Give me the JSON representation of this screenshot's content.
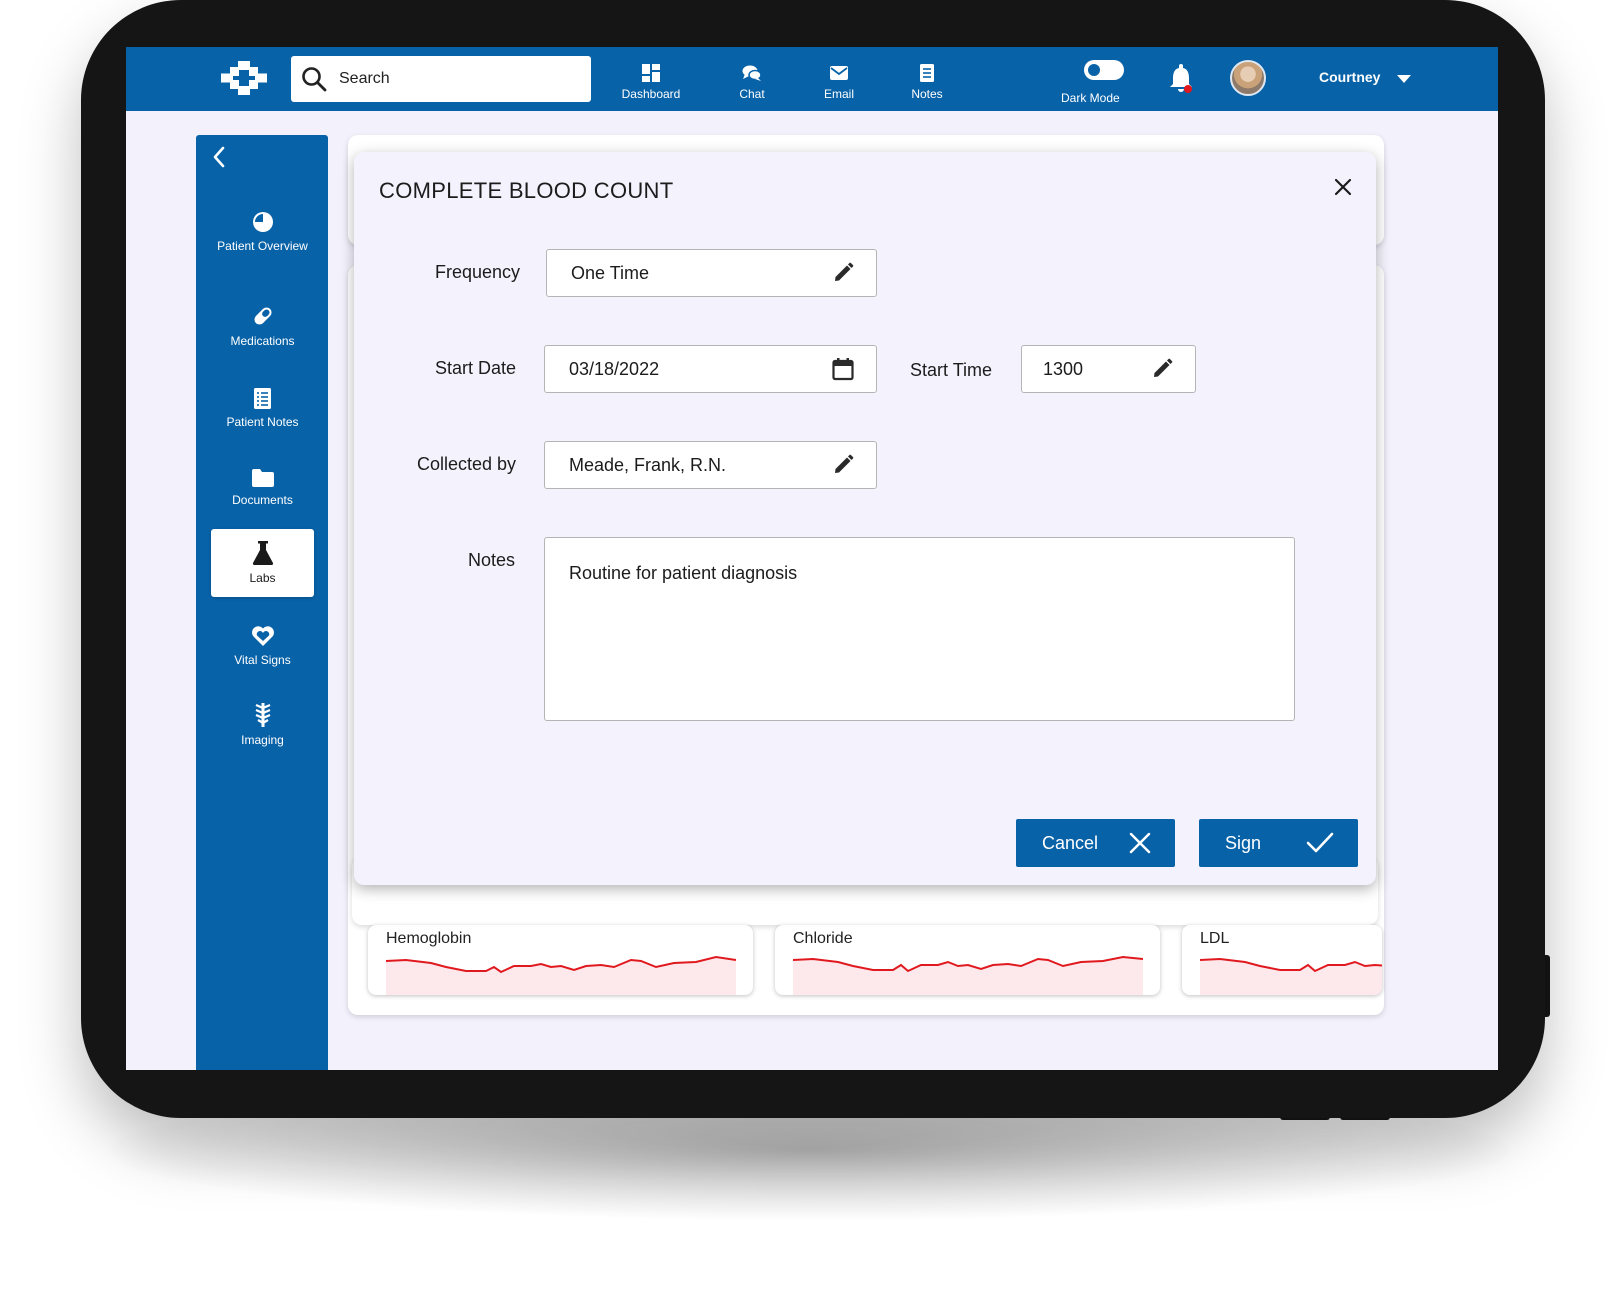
{
  "topbar": {
    "search_placeholder": "Search",
    "nav": [
      {
        "label": "Dashboard",
        "icon": "dashboard-icon"
      },
      {
        "label": "Chat",
        "icon": "chat-icon"
      },
      {
        "label": "Email",
        "icon": "email-icon"
      },
      {
        "label": "Notes",
        "icon": "notes-icon"
      }
    ],
    "dark_mode_label": "Dark Mode",
    "user_name": "Courtney"
  },
  "sidebar": {
    "items": [
      {
        "label": "Patient Overview",
        "icon": "pie-chart-icon",
        "active": false
      },
      {
        "label": "Medications",
        "icon": "pill-icon",
        "active": false
      },
      {
        "label": "Patient Notes",
        "icon": "notes-list-icon",
        "active": false
      },
      {
        "label": "Documents",
        "icon": "folder-icon",
        "active": false
      },
      {
        "label": "Labs",
        "icon": "flask-icon",
        "active": true
      },
      {
        "label": "Vital Signs",
        "icon": "heart-icon",
        "active": false
      },
      {
        "label": "Imaging",
        "icon": "spine-icon",
        "active": false
      }
    ]
  },
  "modal": {
    "title": "COMPLETE BLOOD COUNT",
    "frequency_label": "Frequency",
    "frequency_value": "One Time",
    "start_date_label": "Start Date",
    "start_date_value": "03/18/2022",
    "start_time_label": "Start Time",
    "start_time_value": "1300",
    "collected_by_label": "Collected by",
    "collected_by_value": "Meade, Frank, R.N.",
    "notes_label": "Notes",
    "notes_value": "Routine for patient diagnosis",
    "cancel_label": "Cancel",
    "sign_label": "Sign"
  },
  "lab_cards": [
    {
      "label": "Hemoglobin"
    },
    {
      "label": "Chloride"
    },
    {
      "label": "LDL"
    }
  ],
  "colors": {
    "primary": "#0862a8",
    "background": "#f3f1fb",
    "trend_line": "#e0191e",
    "notification_dot": "#e0191e"
  }
}
